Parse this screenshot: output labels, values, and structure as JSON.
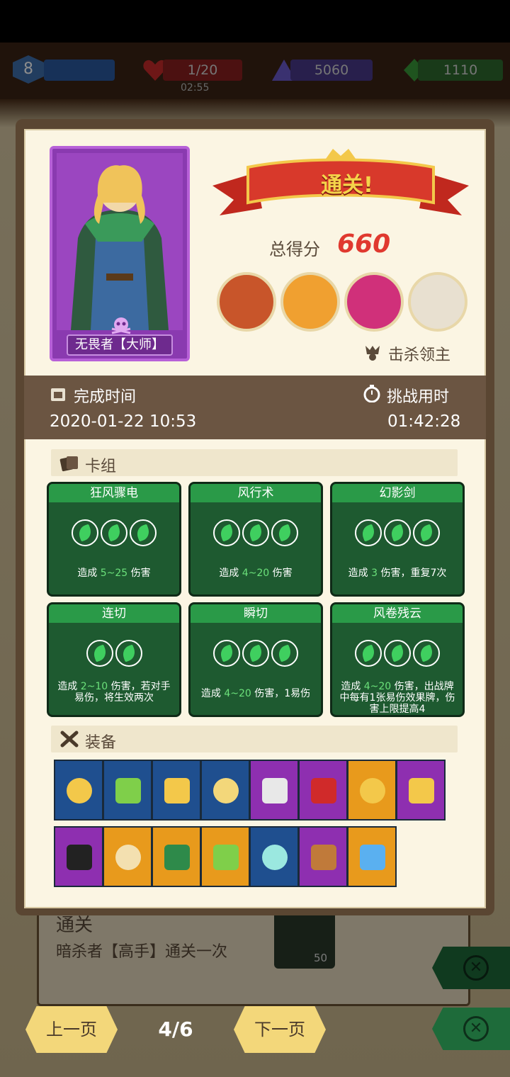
{
  "hud": {
    "level": "8",
    "hp": "1/20",
    "gold": "5060",
    "gems": "1110",
    "timer": "02:55"
  },
  "background_card": {
    "title": "通关",
    "subtitle": "暗杀者【高手】通关一次",
    "reward": "50"
  },
  "result": {
    "banner": "通关!",
    "hero_name": "无畏者【大师】",
    "score_label": "总得分",
    "score": "660",
    "bosses_label": "击杀领主",
    "finish_time_label": "完成时间",
    "finish_time": "2020-01-22 10:53",
    "duration_label": "挑战用时",
    "duration": "01:42:28"
  },
  "deck": {
    "label": "卡组",
    "cards": [
      {
        "name": "狂风骤电",
        "cost": 3,
        "desc_pre": "造成 ",
        "desc_hl": "5~25",
        "desc_post": " 伤害"
      },
      {
        "name": "风行术",
        "cost": 3,
        "desc_pre": "造成 ",
        "desc_hl": "4~20",
        "desc_post": " 伤害"
      },
      {
        "name": "幻影剑",
        "cost": 3,
        "desc_pre": "造成 ",
        "desc_hl": "3",
        "desc_post": " 伤害，重复7次"
      },
      {
        "name": "连切",
        "cost": 2,
        "desc_pre": "造成 ",
        "desc_hl": "2~10",
        "desc_post": " 伤害，若对手易伤，将生效两次"
      },
      {
        "name": "瞬切",
        "cost": 3,
        "desc_pre": "造成 ",
        "desc_hl": "4~20",
        "desc_post": " 伤害，1易伤"
      },
      {
        "name": "风卷残云",
        "cost": 3,
        "desc_pre": "造成 ",
        "desc_hl": "4~20",
        "desc_post": " 伤害，出战牌中每有1张易伤效果牌，伤害上限提高4"
      }
    ]
  },
  "equipment": {
    "label": "装备",
    "items": [
      {
        "icon": "helmet-icon",
        "color": "#1f4f8f"
      },
      {
        "icon": "treasure-chest-icon",
        "color": "#1f4f8f"
      },
      {
        "icon": "moon-staff-icon",
        "color": "#1f4f8f"
      },
      {
        "icon": "gold-bars-icon",
        "color": "#1f4f8f"
      },
      {
        "icon": "dagger-icon",
        "color": "#8e2fb0"
      },
      {
        "icon": "ruby-icon",
        "color": "#8e2fb0"
      },
      {
        "icon": "sun-badge-icon",
        "color": "#e89a1c"
      },
      {
        "icon": "gold-coin-icon",
        "color": "#8e2fb0"
      },
      {
        "icon": "skull-stripes-icon",
        "color": "#8e2fb0"
      },
      {
        "icon": "scroll-icon",
        "color": "#e89a1c"
      },
      {
        "icon": "green-stone-icon",
        "color": "#e89a1c"
      },
      {
        "icon": "feather-icon",
        "color": "#e89a1c"
      },
      {
        "icon": "jewelry-box-icon",
        "color": "#1f4f8f"
      },
      {
        "icon": "boot-icon",
        "color": "#8e2fb0"
      },
      {
        "icon": "blue-crystal-icon",
        "color": "#e89a1c"
      }
    ]
  },
  "nav": {
    "prev": "上一页",
    "next": "下一页",
    "page": "4/6"
  },
  "colors": {
    "accent_red": "#e0392f",
    "deck_green": "#1e5a30",
    "leaf_green": "#3fcf5f",
    "button_yellow": "#f3d77a"
  }
}
